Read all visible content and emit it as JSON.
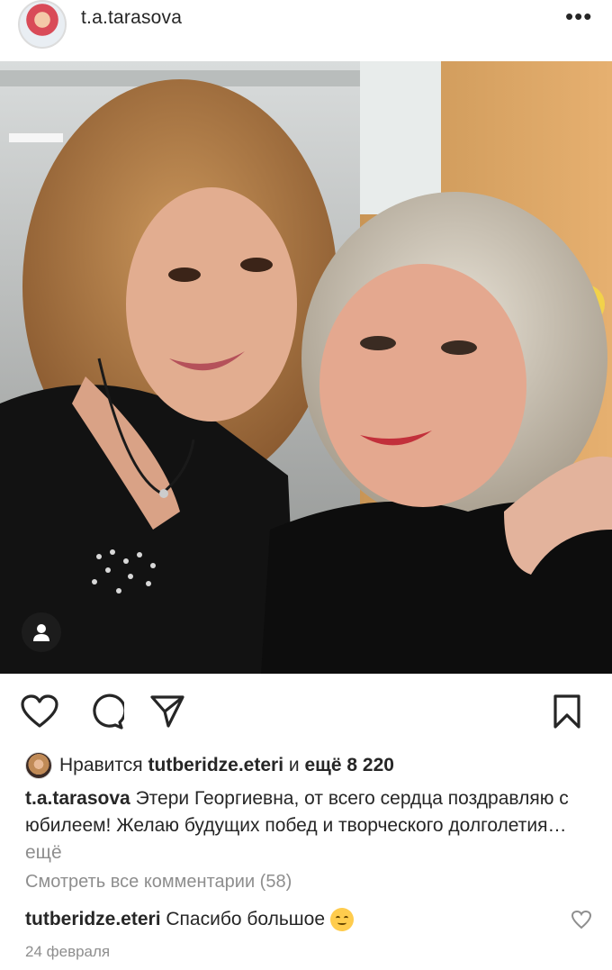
{
  "post": {
    "username": "t.a.tarasova",
    "more_icon": "more-horizontal-icon",
    "photo_alt": "",
    "likes": {
      "prefix": "Нравится",
      "liker": "tutberidze.eteri",
      "connector": "и",
      "others": "ещё 8 220"
    },
    "caption": {
      "author": "t.a.tarasova",
      "text": "Этери Георгиевна, от всего сердца поздравляю с юбилеем! Желаю будущих побед и творческого долголетия…",
      "more": "ещё"
    },
    "view_comments": "Смотреть все комментарии (58)",
    "comment": {
      "author": "tutberidze.eteri",
      "text": "Спасибо большое"
    },
    "date": "24 февраля"
  },
  "icons": {
    "like": "heart-icon",
    "comment": "comment-icon",
    "share": "paper-plane-icon",
    "save": "bookmark-icon",
    "tag": "user-tag-icon"
  },
  "colors": {
    "text": "#262626",
    "secondary": "#8e8e8e",
    "background": "#ffffff"
  }
}
